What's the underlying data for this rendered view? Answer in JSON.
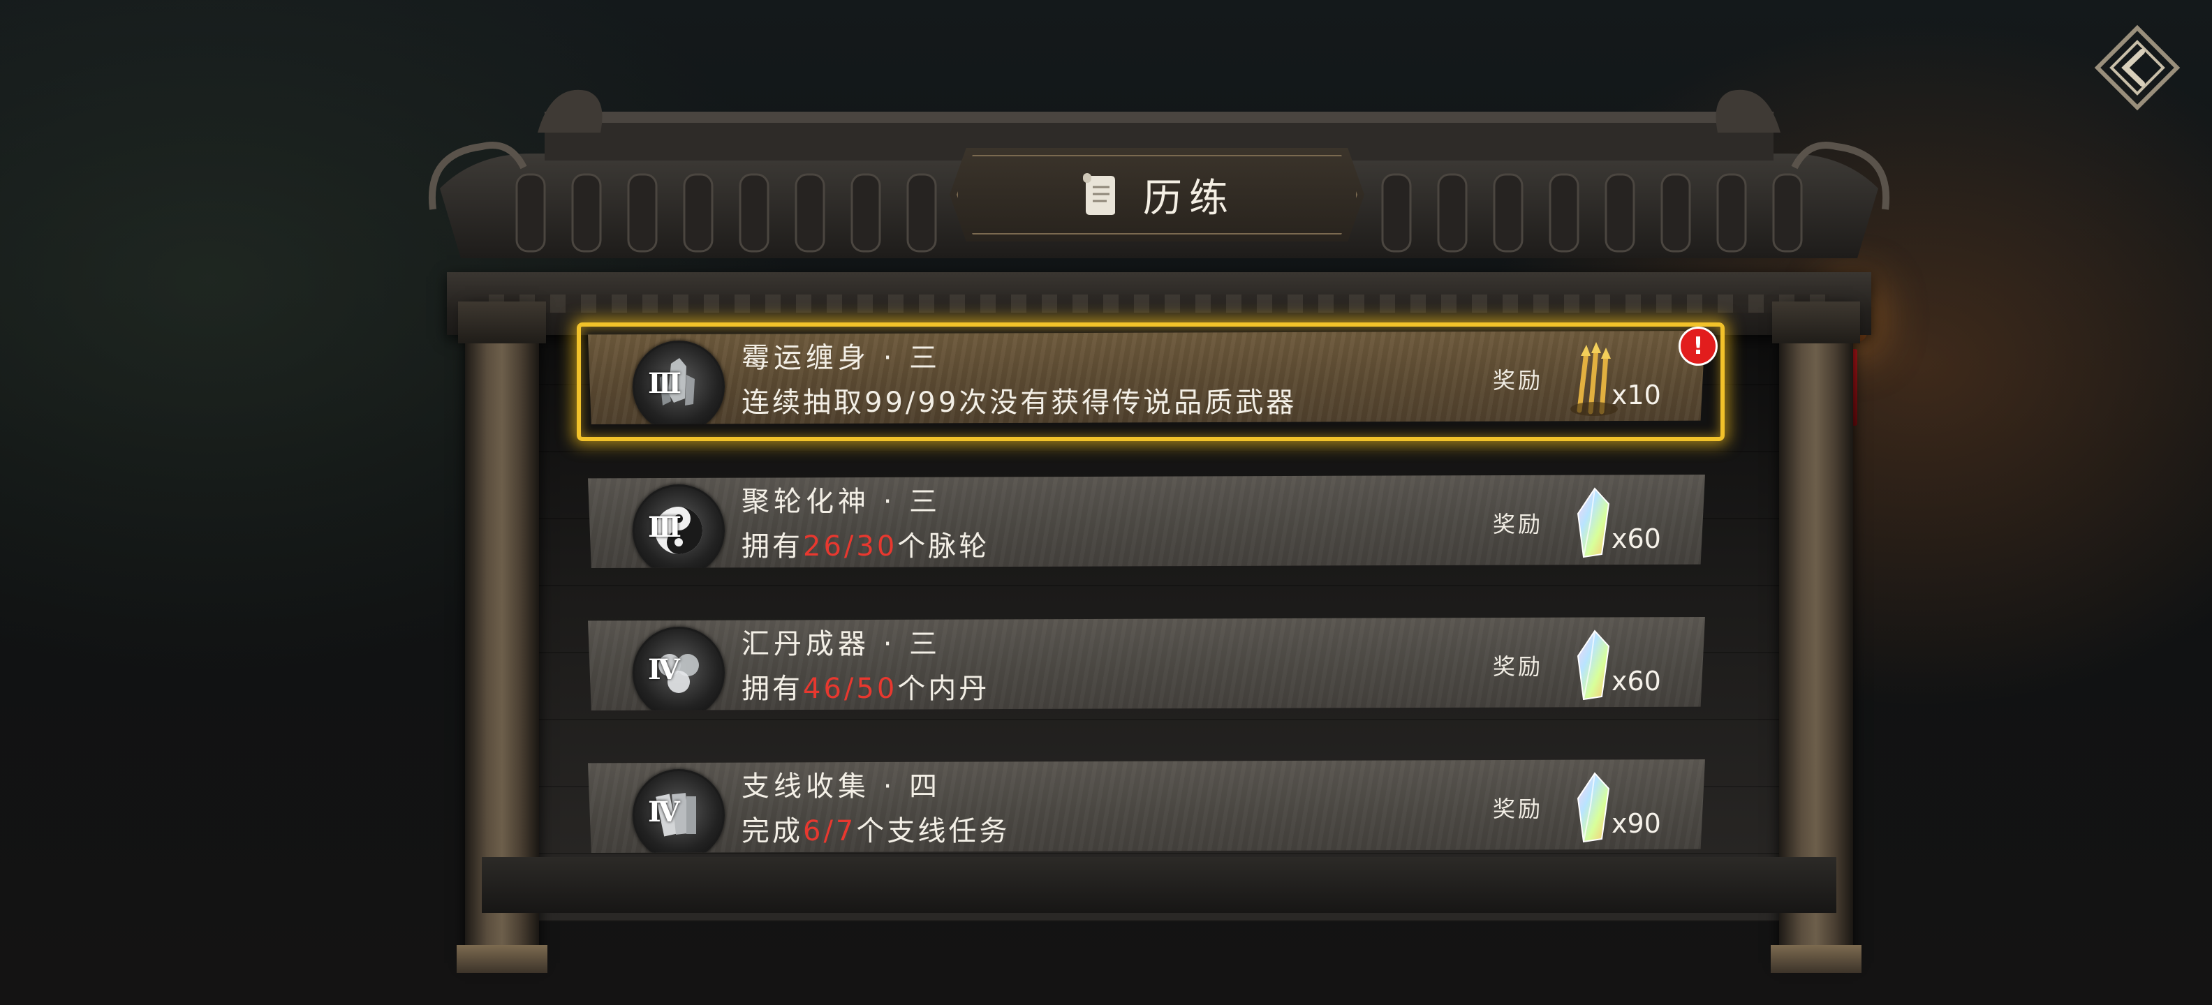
{
  "header": {
    "title": "历练",
    "back_icon": "diamond-back-arrow-icon"
  },
  "tasks": [
    {
      "name": "霉运缠身 · 三",
      "desc_prefix": "连续抽取99/99次没有获得传说品质武器",
      "progress": "",
      "desc_suffix": "",
      "tier": "III",
      "icon": "crystal-cluster-icon",
      "reward_label": "奖励",
      "reward_icon": "golden-arrows-icon",
      "reward_qty": "x10",
      "highlighted": true,
      "alert": "!"
    },
    {
      "name": "聚轮化神 · 三",
      "desc_prefix": "拥有",
      "progress": "26/30",
      "desc_suffix": "个脉轮",
      "tier": "III",
      "icon": "yin-yang-icon",
      "reward_label": "奖励",
      "reward_icon": "rainbow-crystal-icon",
      "reward_qty": "x60",
      "highlighted": false
    },
    {
      "name": "汇丹成器 · 三",
      "desc_prefix": "拥有",
      "progress": "46/50",
      "desc_suffix": "个内丹",
      "tier": "IV",
      "icon": "triple-orb-icon",
      "reward_label": "奖励",
      "reward_icon": "rainbow-crystal-icon",
      "reward_qty": "x60",
      "highlighted": false
    },
    {
      "name": "支线收集 · 四",
      "desc_prefix": "完成",
      "progress": "6/7",
      "desc_suffix": "个支线任务",
      "tier": "IV",
      "icon": "scroll-book-icon",
      "reward_label": "奖励",
      "reward_icon": "rainbow-crystal-icon",
      "reward_qty": "x90",
      "highlighted": false
    }
  ],
  "colors": {
    "highlight_border": "#f2c22a",
    "progress_text": "#e8382f",
    "alert_badge": "#e21d1d"
  }
}
